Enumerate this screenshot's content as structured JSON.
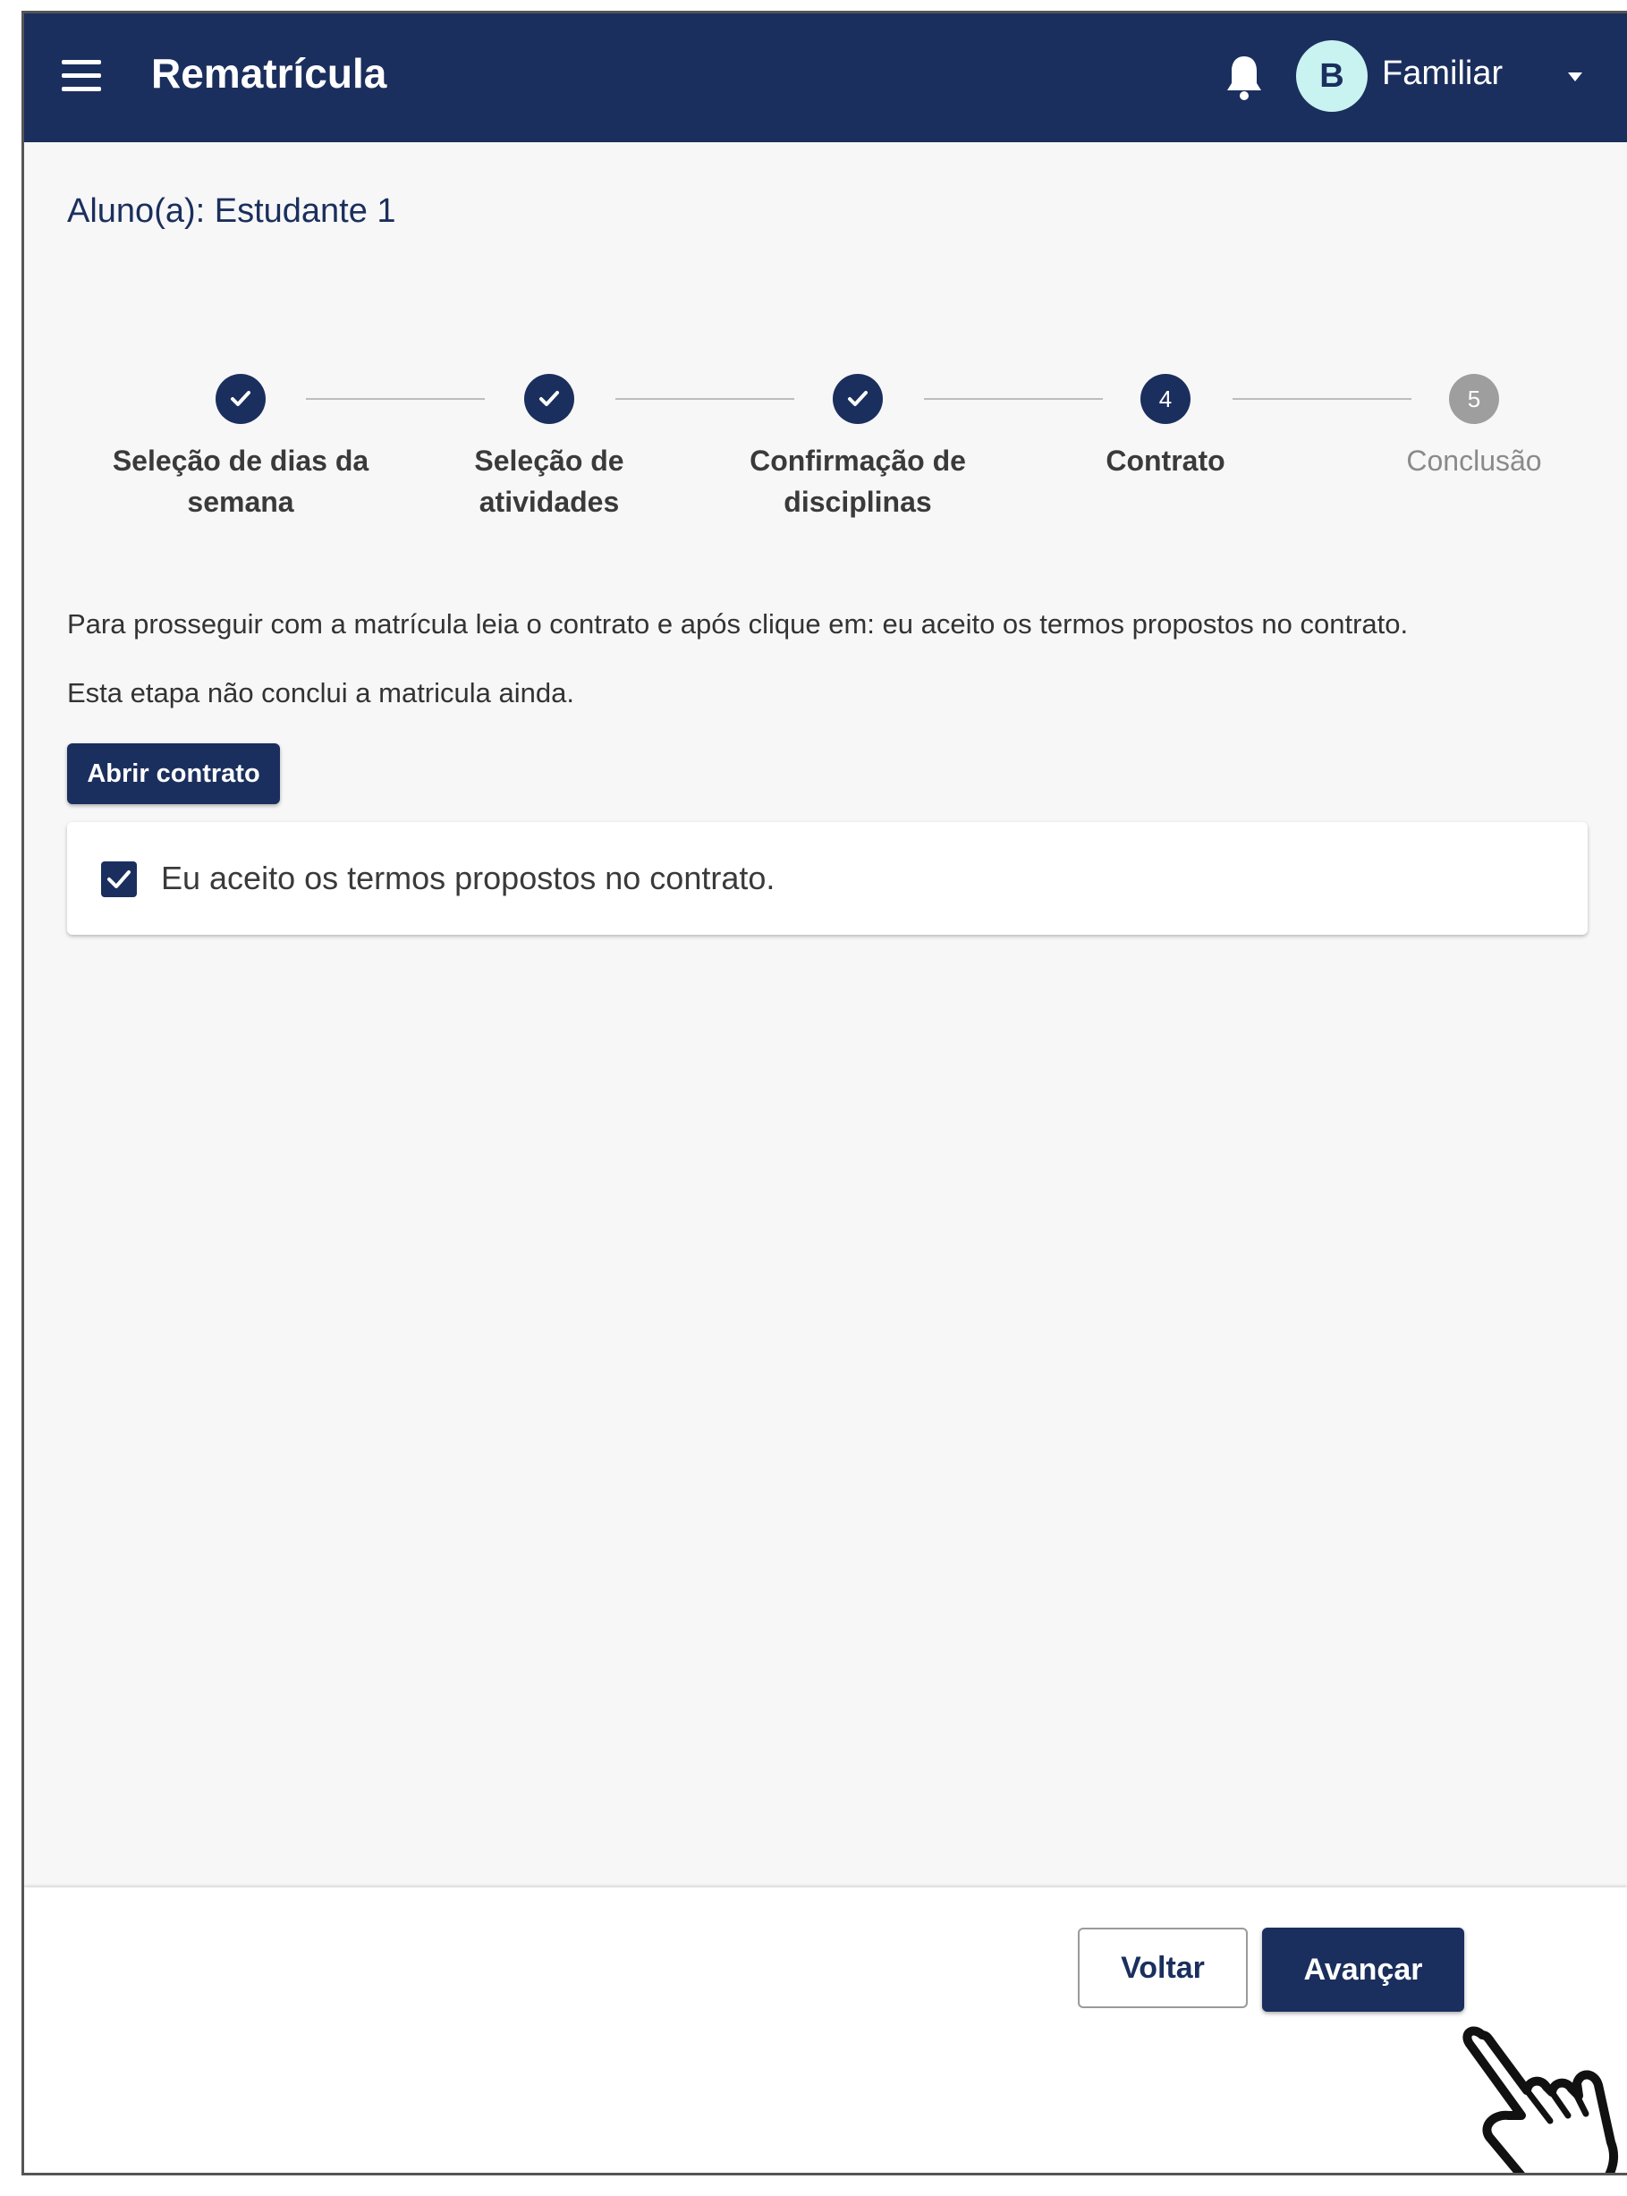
{
  "header": {
    "title": "Rematrícula",
    "avatar_initial": "B",
    "user_name": "Familiar",
    "brand_color": "#1b2f5e"
  },
  "student_label": "Aluno(a): Estudante 1",
  "stepper": {
    "steps": [
      {
        "number": "1",
        "label_line1": "Seleção de dias da",
        "label_line2": "semana",
        "state": "completed"
      },
      {
        "number": "2",
        "label_line1": "Seleção de",
        "label_line2": "atividades",
        "state": "completed"
      },
      {
        "number": "3",
        "label_line1": "Confirmação de",
        "label_line2": "disciplinas",
        "state": "completed"
      },
      {
        "number": "4",
        "label_line1": "Contrato",
        "label_line2": "",
        "state": "active"
      },
      {
        "number": "5",
        "label_line1": "Conclusão",
        "label_line2": "",
        "state": "inactive"
      }
    ]
  },
  "instructions": {
    "line1": "Para prosseguir com a matrícula leia o contrato e após clique em: eu aceito os termos propostos no contrato.",
    "line2": "Esta etapa não conclui a matricula ainda."
  },
  "open_contract_label": "Abrir contrato",
  "accept": {
    "label": "Eu aceito os termos propostos no contrato.",
    "checked": true
  },
  "footer": {
    "back_label": "Voltar",
    "next_label": "Avançar"
  },
  "icons": [
    "menu-icon",
    "bell-icon",
    "caret-down-icon",
    "check-icon",
    "pointing-hand-icon"
  ]
}
